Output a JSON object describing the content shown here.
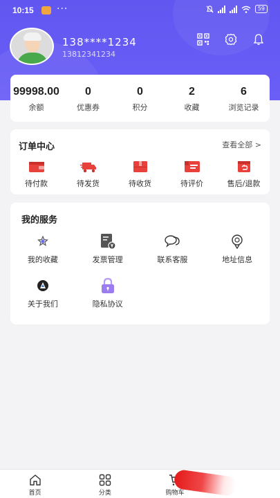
{
  "status_bar": {
    "time": "10:15",
    "dots": "···",
    "battery": "59"
  },
  "profile": {
    "phone_masked": "138****1234",
    "phone_full": "13812341234"
  },
  "header_icons": [
    "qrcode-icon",
    "gear-icon",
    "bell-icon"
  ],
  "stats": [
    {
      "value": "99998.00",
      "label": "余额"
    },
    {
      "value": "0",
      "label": "优惠券"
    },
    {
      "value": "0",
      "label": "积分"
    },
    {
      "value": "2",
      "label": "收藏"
    },
    {
      "value": "6",
      "label": "浏览记录"
    }
  ],
  "orders": {
    "title": "订单中心",
    "see_all": "查看全部 >",
    "items": [
      {
        "label": "待付款",
        "icon": "wallet-icon"
      },
      {
        "label": "待发货",
        "icon": "truck-icon"
      },
      {
        "label": "待收货",
        "icon": "package-icon"
      },
      {
        "label": "待评价",
        "icon": "review-icon"
      },
      {
        "label": "售后/退款",
        "icon": "refund-icon"
      }
    ],
    "accent": "#e8413c"
  },
  "services": {
    "title": "我的服务",
    "items": [
      {
        "label": "我的收藏",
        "icon": "star-icon"
      },
      {
        "label": "发票管理",
        "icon": "invoice-icon"
      },
      {
        "label": "联系客服",
        "icon": "chat-icon"
      },
      {
        "label": "地址信息",
        "icon": "location-icon"
      },
      {
        "label": "关于我们",
        "icon": "about-icon"
      },
      {
        "label": "隐私协议",
        "icon": "lock-icon"
      }
    ]
  },
  "tabbar": [
    {
      "label": "首页",
      "icon": "home-icon"
    },
    {
      "label": "分类",
      "icon": "grid-icon"
    },
    {
      "label": "购物车",
      "icon": "cart-icon"
    },
    {
      "label": "",
      "icon": ""
    }
  ],
  "colors": {
    "brand": "#6157f0",
    "order_red": "#e8413c",
    "lock_purple": "#9b7df0"
  }
}
